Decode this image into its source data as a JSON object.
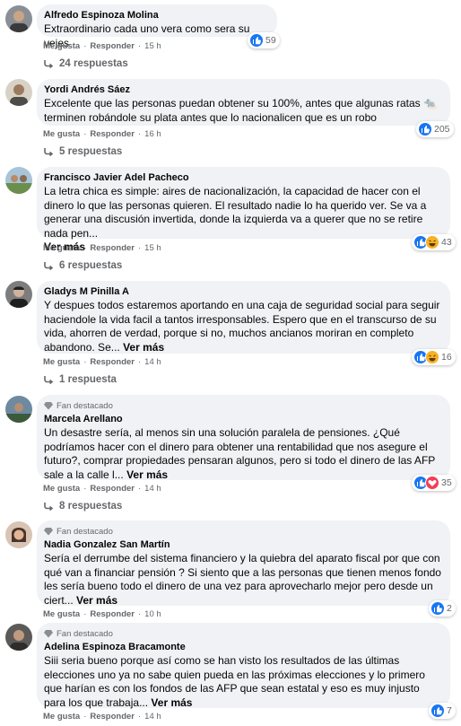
{
  "comments": [
    {
      "name": "Alfredo Espinoza Molina",
      "fan": "",
      "text": "Extraordinario cada uno vera como sera su vejes",
      "more": "",
      "reactions": "59",
      "like": "Me gusta",
      "reply": "Responder",
      "time": "15 h",
      "replies": "24 respuestas"
    },
    {
      "name": "Yordi Andrés Sáez",
      "fan": "",
      "text": "Excelente que las personas puedan obtener su 100%, antes que algunas ratas 🐀 terminen robándole su plata antes que lo nacionalicen que es un robo",
      "more": "",
      "reactions": "205",
      "like": "Me gusta",
      "reply": "Responder",
      "time": "16 h",
      "replies": "5 respuestas"
    },
    {
      "name": "Francisco Javier Adel Pacheco",
      "fan": "",
      "text": "La letra chica es simple: aires de nacionalización, la capacidad de hacer con el dinero lo que las personas quieren. El resultado nadie lo ha querido ver. Se va a generar una discusión invertida, donde la izquierda va a querer que no se retire nada pen...",
      "more": "Ver más",
      "reactions": "43",
      "like": "Me gusta",
      "reply": "Responder",
      "time": "15 h",
      "replies": "6 respuestas"
    },
    {
      "name": "Gladys M Pinilla A",
      "fan": "",
      "text": "Y despues todos estaremos aportando en una caja de seguridad social para seguir haciendole la vida facil a tantos irresponsables. Espero que en el transcurso de su vida, ahorren de verdad, porque si no, muchos ancianos moriran en completo abandono. Se...",
      "more": "Ver más",
      "reactions": "16",
      "like": "Me gusta",
      "reply": "Responder",
      "time": "14 h",
      "replies": "1 respuesta"
    },
    {
      "name": "Marcela Arellano",
      "fan": "Fan destacado",
      "text": "Un desastre sería, al menos sin una solución paralela de pensiones. ¿Qué podríamos hacer con el dinero para obtener una rentabilidad que nos asegure el futuro?, comprar propiedades pensaran algunos, pero si todo el dinero de las AFP sale a la calle l...",
      "more": "Ver más",
      "reactions": "35",
      "like": "Me gusta",
      "reply": "Responder",
      "time": "14 h",
      "replies": "8 respuestas"
    },
    {
      "name": "Nadia Gonzalez San Martín",
      "fan": "Fan destacado",
      "text": "Sería el derrumbe del sistema financiero y la quiebra del aparato fiscal por que con qué van a financiar pensión ? Si siento que a las personas que tienen menos fondo les sería bueno todo el dinero de una vez para aprovecharlo mejor pero desde un ciert...",
      "more": "Ver más",
      "reactions": "2",
      "like": "Me gusta",
      "reply": "Responder",
      "time": "10 h",
      "replies": ""
    },
    {
      "name": "Adelina Espinoza Bracamonte",
      "fan": "Fan destacado",
      "text": "Siii seria bueno porque así como se han visto los resultados de las últimas elecciones uno ya no sabe quien pueda en las próximas elecciones y lo primero que harían es con los fondos de las AFP que sean estatal y eso es muy injusto para los que trabaja...",
      "more": "Ver más",
      "reactions": "7",
      "like": "Me gusta",
      "reply": "Responder",
      "time": "14 h",
      "replies": ""
    }
  ],
  "colors": {
    "like": "#1877f2",
    "haha": "#f7b125",
    "love": "#f33e58",
    "meta": "#65676b",
    "bubble": "#f0f2f5"
  },
  "icons": {
    "like": "thumbs-up-icon",
    "haha": "haha-icon",
    "love": "heart-icon",
    "fan": "diamond-icon",
    "reply": "reply-arrow-icon"
  }
}
